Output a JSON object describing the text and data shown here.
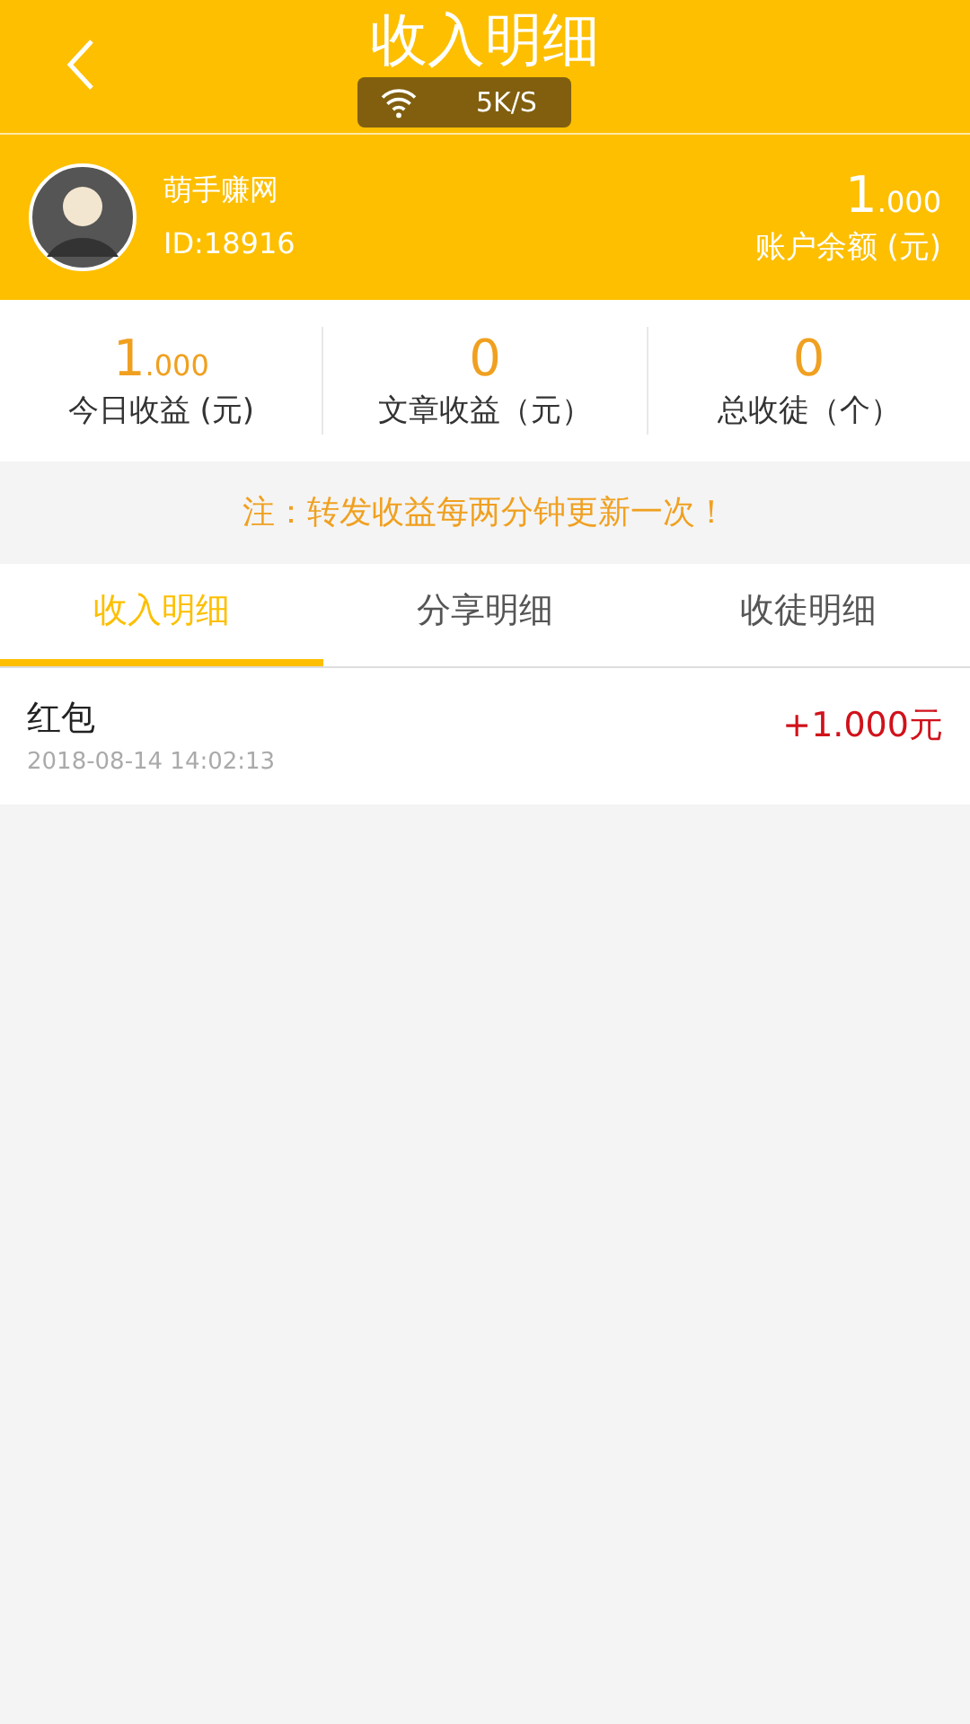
{
  "header": {
    "title": "收入明细",
    "toast": "5K/S"
  },
  "profile": {
    "name": "萌手赚网",
    "id": "ID:18916",
    "balance": {
      "whole": "1",
      "fraction": ".000"
    },
    "balance_label": "账户余额 (元)"
  },
  "stats": [
    {
      "whole": "1",
      "fraction": ".000",
      "label": "今日收益 (元)"
    },
    {
      "whole": "0",
      "label": "文章收益（元）"
    },
    {
      "whole": "0",
      "label": "总收徒（个）"
    }
  ],
  "notice": "注：转发收益每两分钟更新一次！",
  "tabs": [
    {
      "label": "收入明细",
      "selected": true
    },
    {
      "label": "分享明细",
      "selected": false
    },
    {
      "label": "收徒明细",
      "selected": false
    }
  ],
  "records": [
    {
      "title": "红包",
      "time": "2018-08-14 14:02:13",
      "amount": "+1.000元"
    }
  ]
}
